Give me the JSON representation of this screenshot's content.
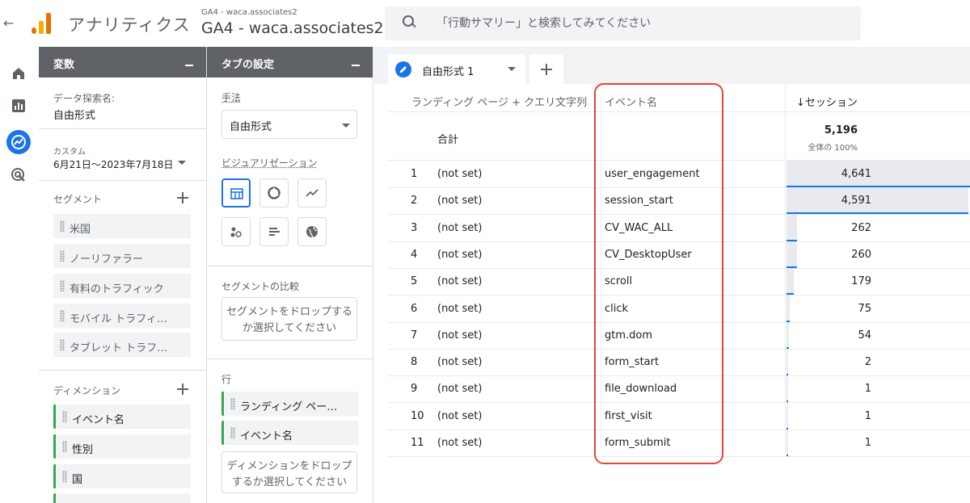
{
  "header": {
    "back": "←",
    "app_name": "アナリティクス",
    "property_sub": "GA4 - waca.associates2",
    "property_main": "GA4 - waca.associates2",
    "search_placeholder": "「行動サマリー」と検索してみてください"
  },
  "rail": {
    "items": [
      {
        "icon": "home-icon"
      },
      {
        "icon": "reports-icon"
      },
      {
        "icon": "explore-icon",
        "active": true
      },
      {
        "icon": "advertising-icon"
      }
    ]
  },
  "variables": {
    "title": "変数",
    "exploration_label": "データ探索名:",
    "exploration_name": "自由形式",
    "date_type": "カスタム",
    "date_range": "6月21日～2023年7月18日",
    "segments_label": "セグメント",
    "segments": [
      "米国",
      "ノーリファラー",
      "有料のトラフィック",
      "モバイル トラフィ…",
      "タブレット トラフ…"
    ],
    "dimensions_label": "ディメンション",
    "dimensions": [
      "イベント名",
      "性別",
      "国"
    ]
  },
  "tab_settings": {
    "title": "タブの設定",
    "method_label": "手法",
    "method_value": "自由形式",
    "viz_label": "ビジュアリゼーション",
    "segment_compare_label": "セグメントの比較",
    "segment_dropzone": "セグメントをドロップするか選択してください",
    "rows_label": "行",
    "row_items": [
      "ランディング ペー…",
      "イベント名"
    ],
    "dimension_dropzone": "ディメンションをドロップするか選択してください"
  },
  "main": {
    "tab_name": "自由形式 1",
    "columns": {
      "landing": "ランディング ページ + クエリ文字列",
      "event": "イベント名",
      "sessions": "↓セッション"
    },
    "total_label": "合計",
    "total_value": "5,196",
    "total_pct": "全体の 100%",
    "rows": [
      {
        "num": "1",
        "landing": "(not set)",
        "event": "user_engagement",
        "sessions": "4,641",
        "value": 4641
      },
      {
        "num": "2",
        "landing": "(not set)",
        "event": "session_start",
        "sessions": "4,591",
        "value": 4591
      },
      {
        "num": "3",
        "landing": "(not set)",
        "event": "CV_WAC_ALL",
        "sessions": "262",
        "value": 262
      },
      {
        "num": "4",
        "landing": "(not set)",
        "event": "CV_DesktopUser",
        "sessions": "260",
        "value": 260
      },
      {
        "num": "5",
        "landing": "(not set)",
        "event": "scroll",
        "sessions": "179",
        "value": 179
      },
      {
        "num": "6",
        "landing": "(not set)",
        "event": "click",
        "sessions": "75",
        "value": 75
      },
      {
        "num": "7",
        "landing": "(not set)",
        "event": "gtm.dom",
        "sessions": "54",
        "value": 54
      },
      {
        "num": "8",
        "landing": "(not set)",
        "event": "form_start",
        "sessions": "2",
        "value": 2
      },
      {
        "num": "9",
        "landing": "(not set)",
        "event": "file_download",
        "sessions": "1",
        "value": 1
      },
      {
        "num": "10",
        "landing": "(not set)",
        "event": "first_visit",
        "sessions": "1",
        "value": 1
      },
      {
        "num": "11",
        "landing": "(not set)",
        "event": "form_submit",
        "sessions": "1",
        "value": 1
      }
    ]
  },
  "colors": {
    "accent": "#1a73e8",
    "panel_header": "#5f6368",
    "highlight": "#ea4335",
    "dimension_chip": "#34a853"
  }
}
